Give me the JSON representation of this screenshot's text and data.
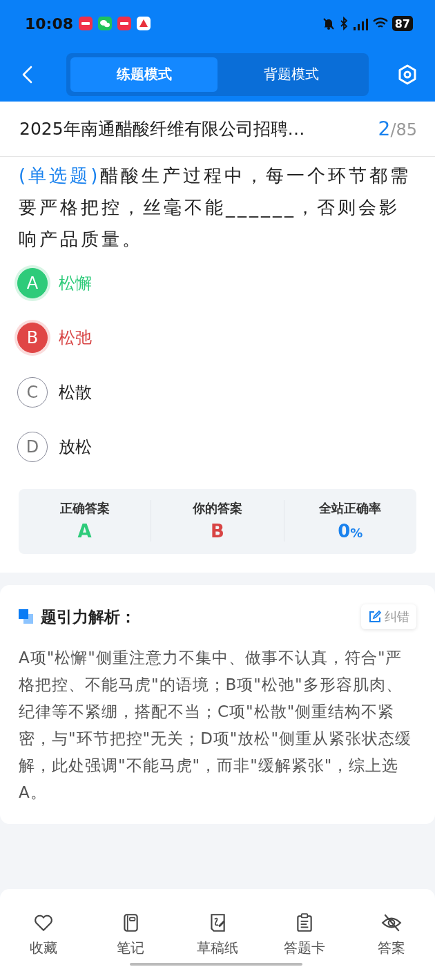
{
  "status_bar": {
    "time": "10:08",
    "battery": "87"
  },
  "header": {
    "tabs": [
      {
        "label": "练题模式",
        "selected": true
      },
      {
        "label": "背题模式",
        "selected": false
      }
    ]
  },
  "title_bar": {
    "title": "2025年南通醋酸纤维有限公司招聘…",
    "current": "2",
    "total": "/85"
  },
  "question": {
    "type_label": "(单选题)",
    "text": "醋酸生产过程中，每一个环节都需要严格把控，丝毫不能______，否则会影响产品质量。"
  },
  "options": [
    {
      "letter": "A",
      "text": "松懈",
      "kind": "correct"
    },
    {
      "letter": "B",
      "text": "松弛",
      "kind": "wrong"
    },
    {
      "letter": "C",
      "text": "松散",
      "kind": "plain"
    },
    {
      "letter": "D",
      "text": "放松",
      "kind": "plain"
    }
  ],
  "answer_summary": [
    {
      "label": "正确答案",
      "value": "A",
      "kind": "correct"
    },
    {
      "label": "你的答案",
      "value": "B",
      "kind": "wrong"
    },
    {
      "label": "全站正确率",
      "value": "0",
      "unit": "%",
      "kind": "rate"
    }
  ],
  "analysis": {
    "title": "题引力解析：",
    "report_button": "纠错",
    "text": "A项\"松懈\"侧重注意力不集中、做事不认真，符合\"严格把控、不能马虎\"的语境；B项\"松弛\"多形容肌肉、纪律等不紧绷，搭配不当；C项\"松散\"侧重结构不紧密，与\"环节把控\"无关；D项\"放松\"侧重从紧张状态缓解，此处强调\"不能马虎\"，而非\"缓解紧张\"，综上选A。"
  },
  "bottom_nav": [
    {
      "label": "收藏",
      "kind": "heart"
    },
    {
      "label": "笔记",
      "kind": "notebook"
    },
    {
      "label": "草稿纸",
      "kind": "draft"
    },
    {
      "label": "答题卡",
      "kind": "clipboard"
    },
    {
      "label": "答案",
      "kind": "eye"
    }
  ]
}
